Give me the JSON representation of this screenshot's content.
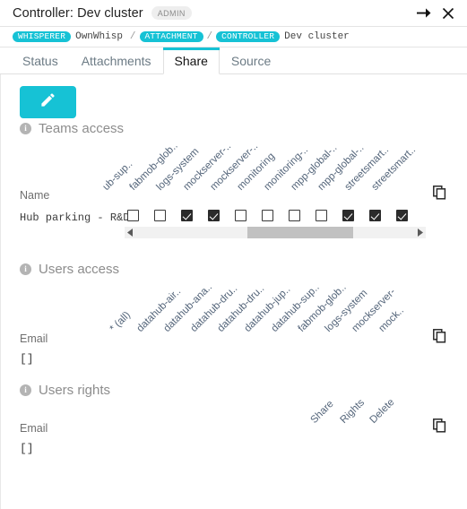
{
  "window": {
    "title": "Controller: Dev cluster",
    "badge": "ADMIN",
    "pin_icon": "pin-icon",
    "close_icon": "close-icon"
  },
  "breadcrumb": {
    "items": [
      {
        "tag": "WHISPERER",
        "text": "OwnWhisp"
      },
      {
        "tag": "ATTACHMENT",
        "text": ""
      },
      {
        "tag": "CONTROLLER",
        "text": "Dev cluster"
      }
    ],
    "separator": "/"
  },
  "tabs": [
    {
      "label": "Status",
      "active": false
    },
    {
      "label": "Attachments",
      "active": false
    },
    {
      "label": "Share",
      "active": true
    },
    {
      "label": "Source",
      "active": false
    }
  ],
  "toolbar": {
    "edit_icon": "pencil-icon"
  },
  "teams_access": {
    "title": "Teams access",
    "info_icon": "info-icon",
    "name_column_label": "Name",
    "copy_icon": "copy-icon",
    "columns": [
      "ub-sup..",
      "fabmob-glob..",
      "logs-system",
      "mockserver-..",
      "mockserver-..",
      "monitoring",
      "monitoring-..",
      "mpp-global-..",
      "mpp-global-..",
      "streetsmart..",
      "streetsmart.."
    ],
    "rows": [
      {
        "name": "Hub parking - R&D",
        "checks": [
          false,
          false,
          true,
          true,
          false,
          false,
          false,
          false,
          true,
          true,
          true
        ]
      }
    ],
    "scrollbar": {
      "left_arrow": "◀",
      "right_arrow": "▶",
      "thumb_start_pct": 40,
      "thumb_width_pct": 38
    }
  },
  "users_access": {
    "title": "Users access",
    "info_icon": "info-icon",
    "email_column_label": "Email",
    "value": "[]",
    "copy_icon": "copy-icon",
    "columns": [
      "* (all)",
      "datahub-air..",
      "datahub-ana..",
      "datahub-dru..",
      "datahub-dru..",
      "datahub-jup..",
      "datahub-sup..",
      "fabmob-glob..",
      "logs-system",
      "mockserver-",
      "mock.."
    ]
  },
  "users_rights": {
    "title": "Users rights",
    "info_icon": "info-icon",
    "email_column_label": "Email",
    "value": "[]",
    "copy_icon": "copy-icon",
    "columns": [
      "Share",
      "Rights",
      "Delete"
    ]
  },
  "colors": {
    "accent": "#16c2d5",
    "tab_inactive": "#6c7b85",
    "header_text": "#54657a",
    "section_title": "#8d8d8d"
  }
}
